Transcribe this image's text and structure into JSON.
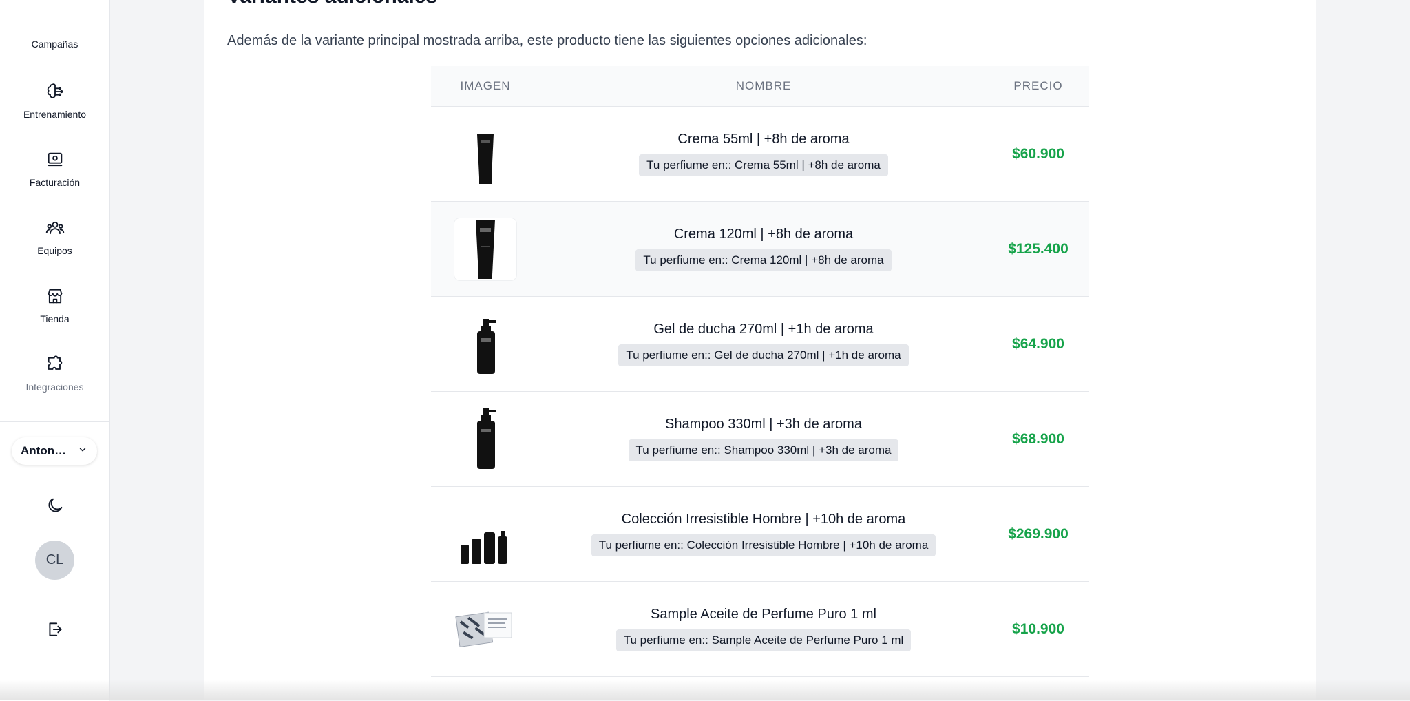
{
  "sidebar": {
    "items": [
      {
        "label": "Campañas",
        "icon": "megaphone-icon"
      },
      {
        "label": "Entrenamiento",
        "icon": "brain-icon"
      },
      {
        "label": "Facturación",
        "icon": "billing-icon"
      },
      {
        "label": "Equipos",
        "icon": "team-icon"
      },
      {
        "label": "Tienda",
        "icon": "store-icon"
      },
      {
        "label": "Integraciones",
        "icon": "puzzle-icon"
      }
    ],
    "user_select": "Anton…",
    "avatar_initials": "CL"
  },
  "section": {
    "title": "Variantes adicionales",
    "intro": "Además de la variante principal mostrada arriba, este producto tiene las siguientes opciones adicionales:"
  },
  "table": {
    "headers": {
      "image": "IMAGEN",
      "name": "NOMBRE",
      "price": "PRECIO"
    },
    "rows": [
      {
        "name": "Crema 55ml | +8h de aroma",
        "tag": "Tu perfiume en:: Crema 55ml | +8h de aroma",
        "price": "$60.900",
        "image": "cream-tube"
      },
      {
        "name": "Crema 120ml | +8h de aroma",
        "tag": "Tu perfiume en:: Crema 120ml | +8h de aroma",
        "price": "$125.400",
        "image": "cream-tube-large"
      },
      {
        "name": "Gel de ducha 270ml | +1h de aroma",
        "tag": "Tu perfiume en:: Gel de ducha 270ml | +1h de aroma",
        "price": "$64.900",
        "image": "pump-bottle"
      },
      {
        "name": "Shampoo 330ml | +3h de aroma",
        "tag": "Tu perfiume en:: Shampoo 330ml | +3h de aroma",
        "price": "$68.900",
        "image": "pump-bottle-tall"
      },
      {
        "name": "Colección Irresistible Hombre | +10h de aroma",
        "tag": "Tu perfiume en:: Colección Irresistible Hombre | +10h de aroma",
        "price": "$269.900",
        "image": "collection"
      },
      {
        "name": "Sample Aceite de Perfume Puro 1 ml",
        "tag": "Tu perfiume en:: Sample Aceite de Perfume Puro 1 ml",
        "price": "$10.900",
        "image": "sample-cards"
      }
    ]
  },
  "colors": {
    "price": "#16a34a",
    "tag_bg": "#e5e7eb",
    "header_bg": "#f9fafb"
  }
}
